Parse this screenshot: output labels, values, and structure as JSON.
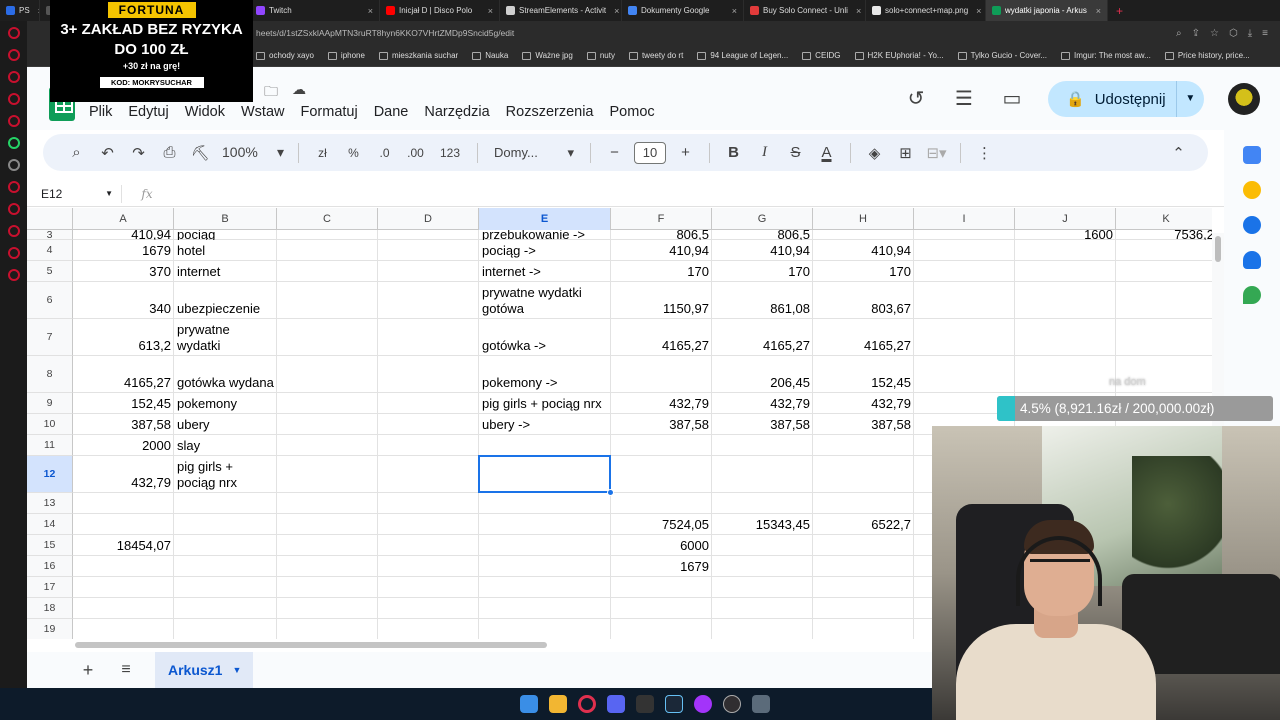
{
  "browser": {
    "tabs": [
      {
        "label": "PS",
        "color": "#2b6ce6"
      },
      {
        "label": "",
        "color": "#555"
      },
      {
        "label": "Twitch",
        "color": "#9146ff"
      },
      {
        "label": "Inicjał D | Disco Polo",
        "color": "#ff0000"
      },
      {
        "label": "StreamElements - Activit",
        "color": "#cfcfcf"
      },
      {
        "label": "Dokumenty Google",
        "color": "#4285f4"
      },
      {
        "label": "Buy Solo Connect - Unli",
        "color": "#e23b3b"
      },
      {
        "label": "solo+connect+map.png",
        "color": "#e8e8e8"
      },
      {
        "label": "wydatki japonia - Arkus",
        "color": "#0f9d58"
      }
    ],
    "url": "heets/d/1stZSxklAApMTN3ruRT8hyn6KKO7VHrtZMDp9Sncid5g/edit",
    "bookmarks": [
      "ochody xayo",
      "iphone",
      "mieszkania suchar",
      "Nauka",
      "Ważne jpg",
      "nuty",
      "tweety do rt",
      "94 League of Legen...",
      "CEIDG",
      "H2K EUphoria! - Yo...",
      "Tylko Gucio - Cover...",
      "Imgur: The most aw...",
      "Price history, price..."
    ]
  },
  "ad": {
    "brand": "FORTUNA",
    "headline_line1": "3+ ZAKŁAD BEZ RYZYKA",
    "headline_line2": "DO 100 ZŁ",
    "sub": "+30 zł na grę!",
    "code": "KOD: MOKRYSUCHAR"
  },
  "menus": [
    "Plik",
    "Edytuj",
    "Widok",
    "Wstaw",
    "Formatuj",
    "Dane",
    "Narzędzia",
    "Rozszerzenia",
    "Pomoc"
  ],
  "share_label": "Udostępnij",
  "toolbar": {
    "zoom": "100%",
    "currency": "zł",
    "percent": "%",
    "dec_less": ".0",
    "dec_more": ".00",
    "format_123": "123",
    "font": "Domy...",
    "font_size": "10"
  },
  "namebox": "E12",
  "fx_label": "fx",
  "columns": [
    "A",
    "B",
    "C",
    "D",
    "E",
    "F",
    "G",
    "H",
    "I",
    "J",
    "K"
  ],
  "selected_column": "E",
  "rows": [
    {
      "n": "3",
      "cells": {
        "A": "410,94",
        "B": "pociąg",
        "E": "przebukowanie ->",
        "F": "806,5",
        "G": "806,5",
        "J": "1600",
        "K": "7536,2"
      }
    },
    {
      "n": "4",
      "cells": {
        "A": "1679",
        "B": "hotel",
        "E": "pociąg ->",
        "F": "410,94",
        "G": "410,94",
        "H": "410,94"
      }
    },
    {
      "n": "5",
      "cells": {
        "A": "370",
        "B": "internet",
        "E": "internet ->",
        "F": "170",
        "G": "170",
        "H": "170"
      }
    },
    {
      "n": "6",
      "cells": {
        "A": "340",
        "B": "ubezpieczenie",
        "E": "prywatne wydatki gotówa",
        "F": "1150,97",
        "G": "861,08",
        "H": "803,67"
      }
    },
    {
      "n": "7",
      "cells": {
        "A": "613,2",
        "B": "prywatne wydatki",
        "E": "gotówka ->",
        "F": "4165,27",
        "G": "4165,27",
        "H": "4165,27"
      }
    },
    {
      "n": "8",
      "cells": {
        "A": "4165,27",
        "B": "gotówka wydana",
        "E": "pokemony ->",
        "G": "206,45",
        "H": "152,45"
      }
    },
    {
      "n": "9",
      "cells": {
        "A": "152,45",
        "B": "pokemony",
        "E": "pig girls + pociąg nrx",
        "F": "432,79",
        "G": "432,79",
        "H": "432,79"
      }
    },
    {
      "n": "10",
      "cells": {
        "A": "387,58",
        "B": "ubery",
        "E": "ubery ->",
        "F": "387,58",
        "G": "387,58",
        "H": "387,58"
      }
    },
    {
      "n": "11",
      "cells": {
        "A": "2000",
        "B": "slay"
      }
    },
    {
      "n": "12",
      "cells": {
        "A": "432,79",
        "B": "pig girls + pociąg nrx"
      }
    },
    {
      "n": "13",
      "cells": {}
    },
    {
      "n": "14",
      "cells": {
        "F": "7524,05",
        "G": "15343,45",
        "H": "6522,7"
      }
    },
    {
      "n": "15",
      "cells": {
        "A": "18454,07",
        "F": "6000"
      }
    },
    {
      "n": "16",
      "cells": {
        "F": "1679"
      }
    },
    {
      "n": "17",
      "cells": {}
    },
    {
      "n": "18",
      "cells": {}
    },
    {
      "n": "19",
      "cells": {}
    }
  ],
  "selected_cell": {
    "col": "E",
    "row": "12"
  },
  "sheet_tab": "Arkusz1",
  "overlay": {
    "label": "na dom",
    "goal_text": "4.5% (8,921.16zł / 200,000.00zł)",
    "goal_fraction": 0.045,
    "goal_color": "#2fc2c8"
  }
}
